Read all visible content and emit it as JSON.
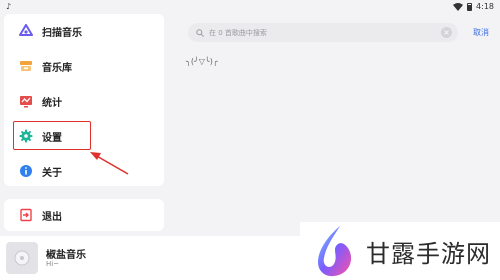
{
  "status_bar": {
    "left_glyph": "♪",
    "time": "4:18"
  },
  "sidebar": {
    "items": [
      {
        "label": "扫描音乐",
        "icon": "scan-music-icon"
      },
      {
        "label": "音乐库",
        "icon": "music-library-icon"
      },
      {
        "label": "统计",
        "icon": "statistics-icon"
      },
      {
        "label": "设置",
        "icon": "settings-gear-icon"
      },
      {
        "label": "关于",
        "icon": "about-info-icon"
      }
    ],
    "logout": {
      "label": "退出",
      "icon": "logout-icon"
    }
  },
  "search": {
    "placeholder": "在 0 首歌曲中搜索",
    "clear_glyph": "×",
    "cancel_label": "取消"
  },
  "empty_state": {
    "kaomoji": "╮(╯▽╰)╭"
  },
  "player": {
    "title": "椒盐音乐",
    "subtitle": "Hi~"
  },
  "watermark": {
    "text": "甘露手游网"
  },
  "colors": {
    "accent": "#3b6fe0",
    "highlight": "#e0312a",
    "scan_icon": "#6b5cf0",
    "library_icon": "#f2a33a",
    "stats_icon": "#e64b4b",
    "settings_icon": "#1fb59a",
    "about_icon": "#2f7ff0",
    "logout_icon": "#f0434b"
  }
}
